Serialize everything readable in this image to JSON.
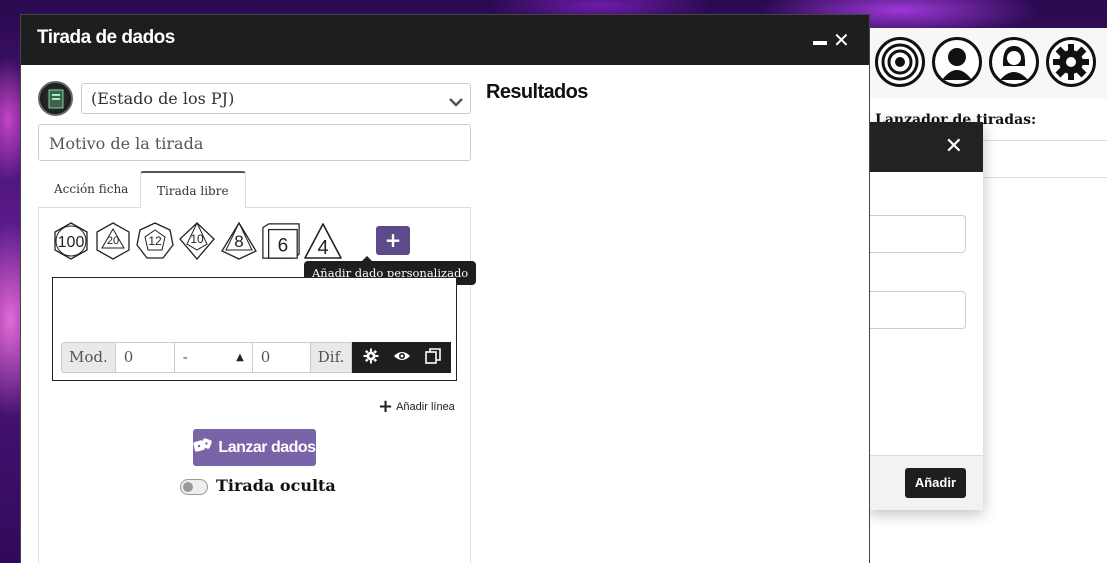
{
  "dialog": {
    "title": "Tirada de dados",
    "character_select": "(Estado de los PJ)",
    "reason_placeholder": "Motivo de la tirada",
    "tabs": [
      {
        "label": "Acción ficha"
      },
      {
        "label": "Tirada libre"
      }
    ],
    "dice": [
      "100",
      "20",
      "12",
      "10",
      "8",
      "6",
      "4"
    ],
    "add_die_label": "+",
    "tooltip": "Añadir dado personalizado",
    "modifier": {
      "mod_label": "Mod.",
      "mod_value": "0",
      "select_value": "-",
      "dif_value": "0",
      "dif_label": "Dif."
    },
    "add_line_label": "Añadir línea",
    "roll_button_label": "Lanzar dados",
    "hidden_roll_label": "Tirada oculta",
    "results_title": "Resultados"
  },
  "background": {
    "panel_label": "Lanzador de tiradas:",
    "modal_add_button": "Añadir"
  },
  "colors": {
    "header": "#1e1e1e",
    "accent": "#7a64a8",
    "add_die": "#5c4a8a"
  }
}
